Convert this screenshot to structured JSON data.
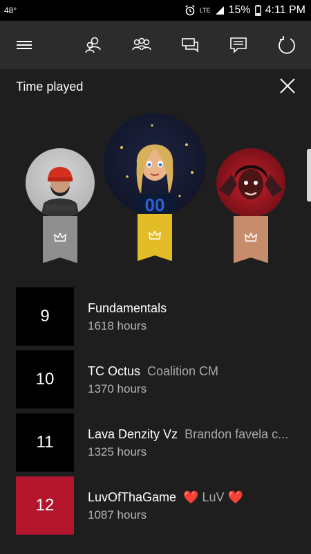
{
  "status_bar": {
    "temperature": "48°",
    "network": "LTE",
    "battery": "15%",
    "time": "4:11 PM",
    "icons": [
      "alarm-icon",
      "signal-icon",
      "battery-icon"
    ]
  },
  "nav": {
    "items": [
      {
        "name": "menu-icon"
      },
      {
        "name": "friends-icon"
      },
      {
        "name": "party-icon"
      },
      {
        "name": "messages-icon"
      },
      {
        "name": "activity-feed-icon"
      },
      {
        "name": "refresh-icon"
      }
    ]
  },
  "panel": {
    "title": "Time played",
    "close_icon": "close-icon"
  },
  "podium": [
    {
      "place": "second",
      "ribbon_color": "#8f8f8f",
      "icon": "crown-icon"
    },
    {
      "place": "first",
      "ribbon_color": "#e3bd27",
      "icon": "crown-icon"
    },
    {
      "place": "third",
      "ribbon_color": "#c58d6c",
      "icon": "crown-icon"
    }
  ],
  "leaderboard": [
    {
      "rank": "9",
      "gamertag": "Fundamentals",
      "real_name": "",
      "hours": "1618 hours"
    },
    {
      "rank": "10",
      "gamertag": "TC Octus",
      "real_name": "Coalition CM",
      "hours": "1370 hours"
    },
    {
      "rank": "11",
      "gamertag": "Lava Denzity Vz",
      "real_name": "Brandon favela c...",
      "hours": "1325 hours"
    },
    {
      "rank": "12",
      "gamertag": "LuvOfThaGame",
      "real_name_prefix": "❤️",
      "real_name_text": "LuV",
      "real_name_suffix": "❤️",
      "hours": "1087 hours"
    }
  ],
  "colors": {
    "highlight": "#b3152c",
    "app_bar": "#2c2c2c",
    "background": "#1e1e1e"
  }
}
